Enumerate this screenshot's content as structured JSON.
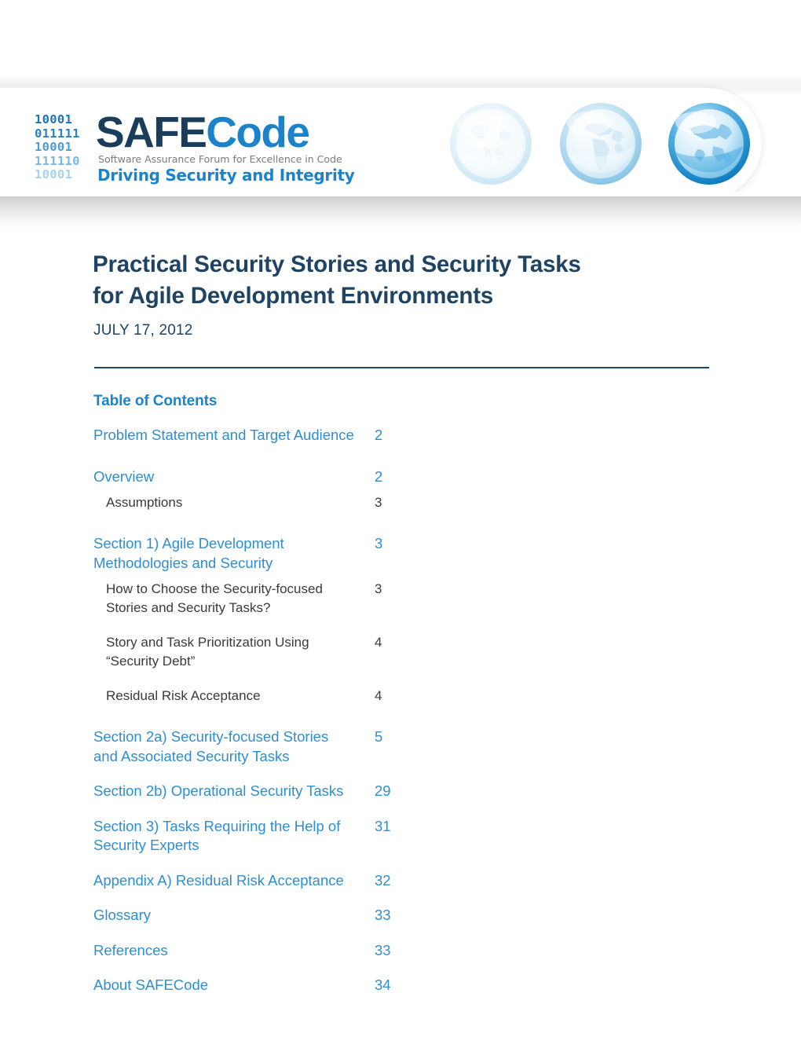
{
  "header": {
    "logo": {
      "binary_rows": [
        "10001",
        "011111",
        "10001",
        "111110",
        "10001"
      ],
      "wordmark_part1": "SAFE",
      "wordmark_part2": "Code",
      "tagline_top": "Software Assurance Forum for Excellence in Code",
      "tagline_main": "Driving Security and Integrity",
      "color_safe": "#1b3d5c",
      "color_code": "#1b83cc"
    },
    "globes": [
      {
        "name": "globe-americas-icon"
      },
      {
        "name": "globe-europe-africa-icon"
      },
      {
        "name": "globe-asia-pacific-icon"
      }
    ]
  },
  "document": {
    "title": "Practical Security Stories and Security Tasks\nfor Agile Development Environments",
    "title_line1": "Practical Security Stories and Security Tasks",
    "title_line2": "for Agile Development Environments",
    "date": "JULY 17, 2012",
    "title_color": "#1e4363",
    "rule_color": "#1c4a63"
  },
  "toc": {
    "heading": "Table of Contents",
    "heading_color": "#1b83cc",
    "entry_color": "#2f8ed0",
    "sub_entry_color": "#3a3a3a",
    "entries": [
      {
        "level": 1,
        "label": "Problem Statement and Target Audience",
        "page": "2",
        "spacing": "lg"
      },
      {
        "level": 1,
        "label": "Overview",
        "page": "2",
        "spacing": "sm"
      },
      {
        "level": 2,
        "label": "Assumptions",
        "page": "3",
        "spacing": "lg"
      },
      {
        "level": 1,
        "label": "Section 1) Agile Development\nMethodologies and Security",
        "page": "3",
        "spacing": "sm"
      },
      {
        "level": 2,
        "label": "How to Choose the Security-focused\nStories and Security Tasks?",
        "page": "3",
        "spacing": "md"
      },
      {
        "level": 2,
        "label": "Story and Task Prioritization Using\n“Security Debt”",
        "page": "4",
        "spacing": "md"
      },
      {
        "level": 2,
        "label": "Residual Risk Acceptance",
        "page": "4",
        "spacing": "lg"
      },
      {
        "level": 1,
        "label": "Section 2a) Security-focused Stories\nand Associated Security Tasks",
        "page": "5",
        "spacing": "md"
      },
      {
        "level": 1,
        "label": "Section 2b) Operational Security Tasks",
        "page": "29",
        "spacing": "md"
      },
      {
        "level": 1,
        "label": "Section 3) Tasks Requiring the Help of\nSecurity Experts",
        "page": "31",
        "spacing": "md"
      },
      {
        "level": 1,
        "label": "Appendix A) Residual Risk Acceptance",
        "page": "32",
        "spacing": "md"
      },
      {
        "level": 1,
        "label": "Glossary",
        "page": "33",
        "spacing": "md"
      },
      {
        "level": 1,
        "label": "References",
        "page": "33",
        "spacing": "md"
      },
      {
        "level": 1,
        "label": "About SAFECode",
        "page": "34",
        "spacing": "md"
      }
    ]
  }
}
